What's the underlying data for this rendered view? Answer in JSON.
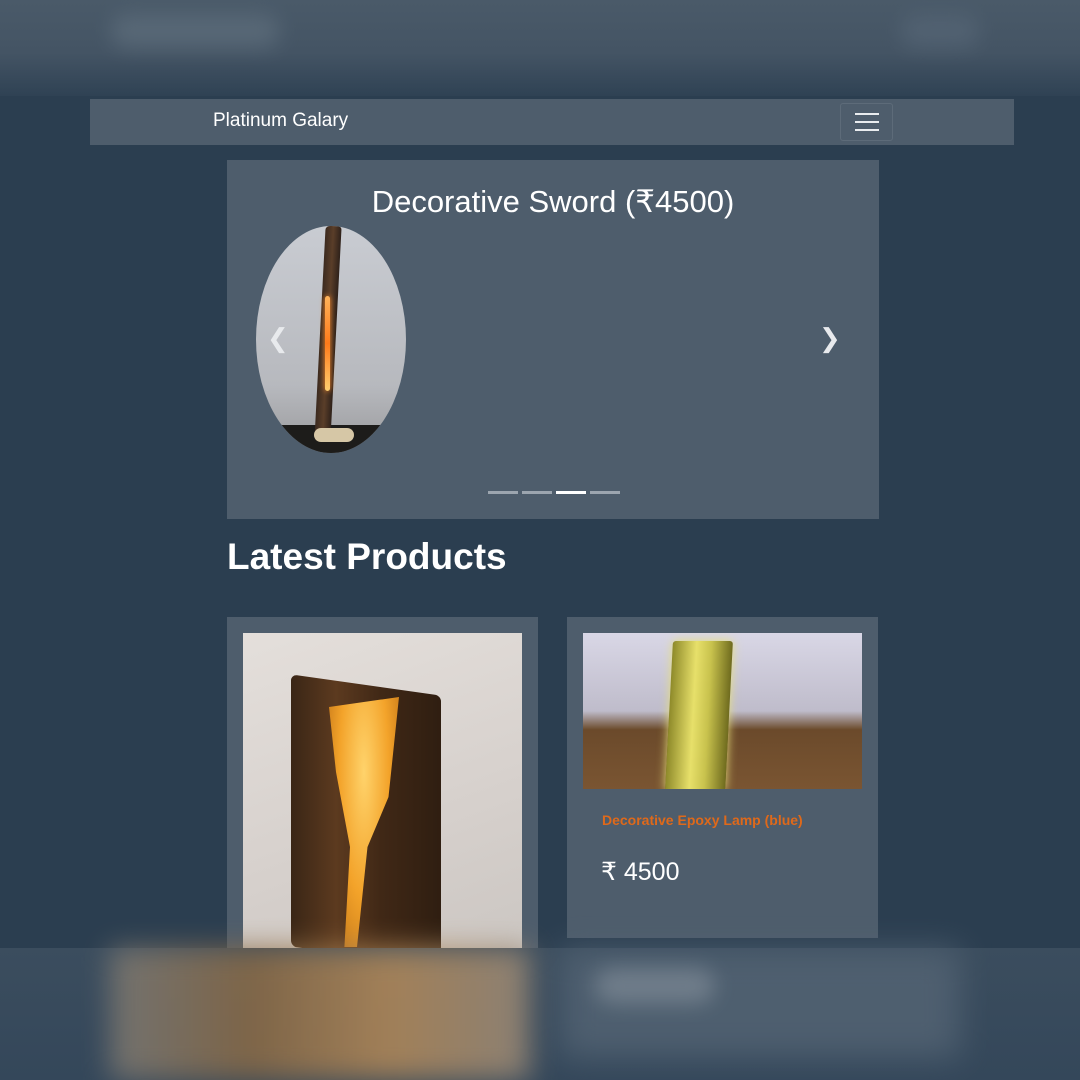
{
  "navbar": {
    "brand": "Platinum Galary",
    "toggler_icon": "hamburger-menu-icon"
  },
  "carousel": {
    "caption": "Decorative Sword (₹4500)",
    "prev_icon": "chevron-left-icon",
    "next_icon": "chevron-right-icon",
    "slide_count": 4,
    "active_slide": 3
  },
  "section": {
    "title": "Latest Products"
  },
  "products": [
    {
      "name": "",
      "price": ""
    },
    {
      "name": "Decorative Epoxy Lamp (blue)",
      "price": "₹ 4500"
    }
  ],
  "colors": {
    "background": "#2b3e50",
    "panel": "#4e5d6c",
    "accent": "#df691a",
    "text": "#ffffff"
  }
}
